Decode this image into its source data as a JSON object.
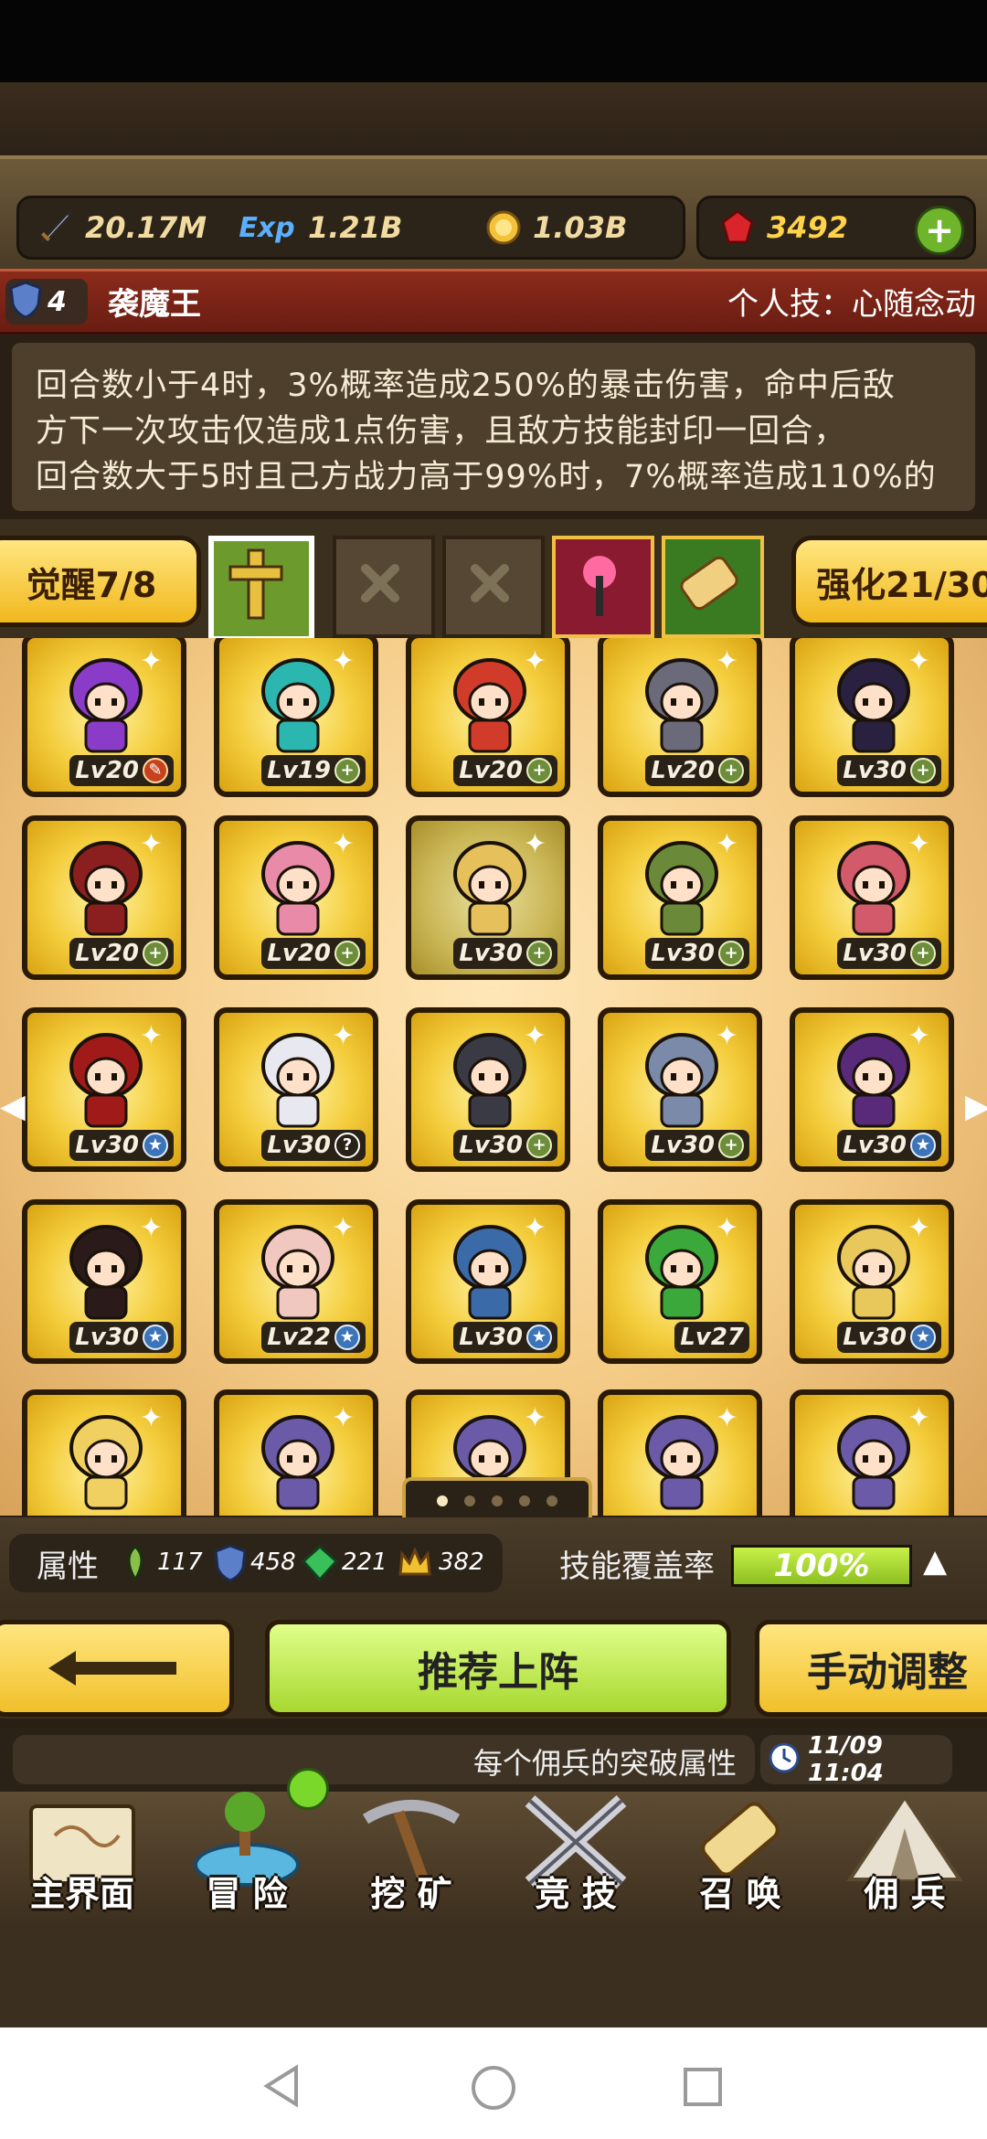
{
  "resources": {
    "attack": "20.17M",
    "exp_label": "Exp",
    "exp": "1.21B",
    "gold": "1.03B",
    "gems": "3492"
  },
  "hero": {
    "rank": "4",
    "name": "袭魔王",
    "skill_title": "个人技：心随念动",
    "description_lines": [
      "回合数小于4时，3%概率造成250%的暴击伤害，命中后敌",
      "方下一次攻击仅造成1点伤害，且敌方技能封印一回合，",
      "回合数大于5时且己方战力高于99%时，7%概率造成110%的"
    ]
  },
  "awaken": {
    "label": "觉醒7/8"
  },
  "enhance": {
    "label": "强化21/30"
  },
  "slots": [
    "cross-slot-selected",
    "empty-slot",
    "empty-slot",
    "staff-slot",
    "scroll-slot"
  ],
  "roster": [
    [
      {
        "lv": "Lv20",
        "badge": "edit",
        "hair": "#8a3cc8"
      },
      {
        "lv": "Lv19",
        "badge": "plus",
        "hair": "#2bb6b0"
      },
      {
        "lv": "Lv20",
        "badge": "plus",
        "hair": "#d13c2a"
      },
      {
        "lv": "Lv20",
        "badge": "plus",
        "hair": "#6a6a7a"
      },
      {
        "lv": "Lv30",
        "badge": "plus",
        "hair": "#2a2040"
      }
    ],
    [
      {
        "lv": "Lv20",
        "badge": "plus",
        "hair": "#8b1f1f"
      },
      {
        "lv": "Lv20",
        "badge": "plus",
        "hair": "#e88aa8"
      },
      {
        "lv": "Lv30",
        "badge": "plus",
        "hair": "#e6c05a"
      },
      {
        "lv": "Lv30",
        "badge": "plus",
        "hair": "#6a8a3a"
      },
      {
        "lv": "Lv30",
        "badge": "plus",
        "hair": "#d25a6a"
      }
    ],
    [
      {
        "lv": "Lv30",
        "badge": "star",
        "hair": "#a01a1a"
      },
      {
        "lv": "Lv30",
        "badge": "q",
        "hair": "#e8e8f0"
      },
      {
        "lv": "Lv30",
        "badge": "plus",
        "hair": "#3a3a44"
      },
      {
        "lv": "Lv30",
        "badge": "plus",
        "hair": "#7a8aa8"
      },
      {
        "lv": "Lv30",
        "badge": "star",
        "hair": "#5a2a7a"
      }
    ],
    [
      {
        "lv": "Lv30",
        "badge": "star",
        "hair": "#2a1a1a"
      },
      {
        "lv": "Lv22",
        "badge": "star",
        "hair": "#f0c8c0"
      },
      {
        "lv": "Lv30",
        "badge": "star",
        "hair": "#3a6aa8"
      },
      {
        "lv": "Lv27",
        "badge": "none",
        "hair": "#3aa83a"
      },
      {
        "lv": "Lv30",
        "badge": "star",
        "hair": "#e8c85a"
      }
    ],
    [
      {
        "lv": "",
        "badge": "none",
        "hair": "#f0d060"
      },
      {
        "lv": "",
        "badge": "none",
        "hair": "#6a5aa8"
      },
      {
        "lv": "",
        "badge": "none",
        "hair": "#6a5aa8"
      },
      {
        "lv": "",
        "badge": "none",
        "hair": "#6a5aa8"
      },
      {
        "lv": "",
        "badge": "none",
        "hair": "#6a5aa8"
      }
    ]
  ],
  "pagination": {
    "pages": 5,
    "current": 1
  },
  "attributes": {
    "label": "属性",
    "wind": "117",
    "shield": "458",
    "nature": "221",
    "crown": "382",
    "coverage_label": "技能覆盖率",
    "coverage_value": "100%",
    "coverage_fraction": 1.0
  },
  "buttons": {
    "recommend": "推荐上阵",
    "manual": "手动调整"
  },
  "notice": {
    "text": "每个佣兵的突破属性",
    "datetime": "11/09 11:04"
  },
  "nav": [
    {
      "label": "主界面",
      "icon": "map-scroll-icon"
    },
    {
      "label": "冒 险",
      "icon": "island-icon"
    },
    {
      "label": "挖 矿",
      "icon": "pickaxe-icon"
    },
    {
      "label": "竞 技",
      "icon": "crossed-swords-icon"
    },
    {
      "label": "召 唤",
      "icon": "summon-scroll-icon"
    },
    {
      "label": "佣 兵",
      "icon": "tent-icon"
    }
  ],
  "colors": {
    "gold": "#f4cd3c",
    "accent_green": "#9bd12a",
    "title_red": "#8b2a1b"
  }
}
